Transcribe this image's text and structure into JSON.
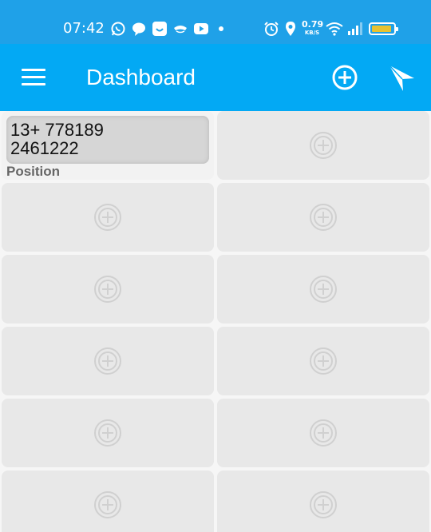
{
  "status_bar": {
    "time": "07:42",
    "speed_value": "0.79",
    "speed_unit": "KB/S",
    "icons": [
      "whatsapp-icon",
      "chat-icon",
      "face-app-icon",
      "cloud-app-icon",
      "youtube-icon",
      "alarm-icon",
      "location-icon",
      "wifi-icon",
      "signal-icon",
      "battery-icon"
    ]
  },
  "app_bar": {
    "title": "Dashboard",
    "menu_icon": "hamburger-menu-icon",
    "add_icon": "add-circle-icon",
    "nav_icon": "navigation-arrow-icon"
  },
  "dashboard": {
    "tiles": [
      {
        "value": "13+ 778189\n2461222",
        "label": "Position"
      },
      {
        "empty": true
      },
      {
        "empty": true
      },
      {
        "empty": true
      },
      {
        "empty": true
      },
      {
        "empty": true
      },
      {
        "empty": true
      },
      {
        "empty": true
      },
      {
        "empty": true
      },
      {
        "empty": true
      },
      {
        "empty": true
      },
      {
        "empty": true
      }
    ]
  },
  "colors": {
    "app_bar": "#03a9f4",
    "status_bar": "#1fa1e8",
    "tile_bg": "#e8e8e8",
    "battery": "#e8c230"
  }
}
